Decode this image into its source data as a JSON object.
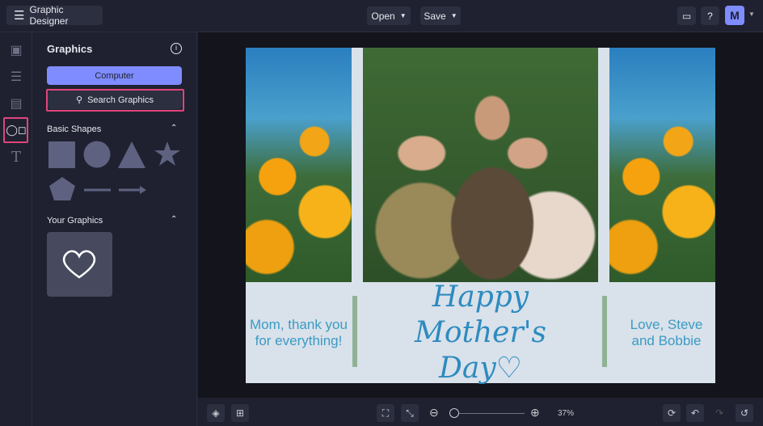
{
  "app": {
    "title": "Graphic Designer",
    "open_label": "Open",
    "save_label": "Save",
    "avatar": "M"
  },
  "panel": {
    "title": "Graphics",
    "computer_label": "Computer",
    "search_label": "Search Graphics",
    "basic_shapes_label": "Basic Shapes",
    "your_graphics_label": "Your Graphics"
  },
  "poster": {
    "left_text": "Mom, thank you for everything!",
    "headline_1": "Happy Mother's",
    "headline_2": "Day♡",
    "right_text": "Love, Steve and Bobbie"
  },
  "zoom": {
    "level": "37%",
    "value": 37
  },
  "colors": {
    "accent": "#7f8cff",
    "highlight": "#e0457b"
  }
}
